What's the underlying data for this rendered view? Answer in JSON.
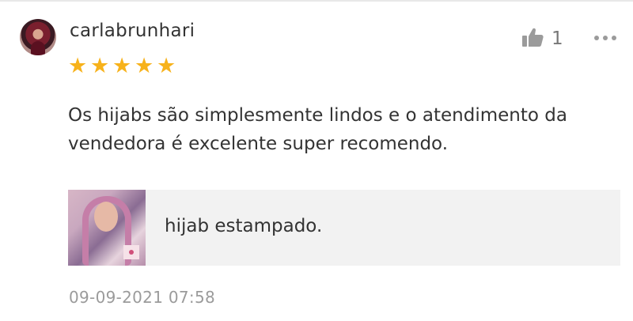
{
  "review": {
    "username": "carlabrunhari",
    "rating": 5,
    "stars": [
      "★",
      "★",
      "★",
      "★",
      "★"
    ],
    "like_count": "1",
    "text": "Os hijabs são simplesmente lindos e o atendimento da vendedora é excelente super recomendo.",
    "product_variant": "hijab estampado.",
    "timestamp": "09-09-2021 07:58"
  },
  "icons": {
    "like": "thumbs-up-icon",
    "more": "more-options-icon"
  },
  "colors": {
    "star": "#f7b21b",
    "text": "#333333",
    "muted": "#9b9b9b",
    "card_bg": "#f2f2f2"
  }
}
